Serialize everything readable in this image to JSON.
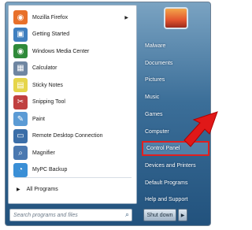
{
  "pinned": [
    {
      "label": "Mozilla Firefox",
      "icon": "firefox-icon",
      "color": "#e8702a",
      "glyph": "◉",
      "has_submenu": true
    },
    {
      "label": "Getting Started",
      "icon": "getting-started-icon",
      "color": "#3f7fbf",
      "glyph": "▣"
    },
    {
      "label": "Windows Media Center",
      "icon": "media-center-icon",
      "color": "#2f8a3a",
      "glyph": "◉"
    },
    {
      "label": "Calculator",
      "icon": "calculator-icon",
      "color": "#6f86a2",
      "glyph": "▦"
    },
    {
      "label": "Sticky Notes",
      "icon": "sticky-notes-icon",
      "color": "#e6d54a",
      "glyph": "▤"
    },
    {
      "label": "Snipping Tool",
      "icon": "snipping-tool-icon",
      "color": "#c04040",
      "glyph": "✂"
    },
    {
      "label": "Paint",
      "icon": "paint-icon",
      "color": "#5b9bd5",
      "glyph": "✎"
    },
    {
      "label": "Remote Desktop Connection",
      "icon": "remote-desktop-icon",
      "color": "#3b6ea8",
      "glyph": "▭"
    },
    {
      "label": "Magnifier",
      "icon": "magnifier-icon",
      "color": "#4a78b0",
      "glyph": "⌕"
    },
    {
      "label": "MyPC Backup",
      "icon": "mypc-backup-icon",
      "color": "#3a8fd6",
      "glyph": "◔"
    }
  ],
  "all_programs": "All Programs",
  "search_placeholder": "Search programs and files",
  "right_items": [
    {
      "label": "Malware",
      "name": "right-item-malware"
    },
    {
      "label": "Documents",
      "name": "right-item-documents"
    },
    {
      "label": "Pictures",
      "name": "right-item-pictures"
    },
    {
      "label": "Music",
      "name": "right-item-music"
    },
    {
      "label": "Games",
      "name": "right-item-games"
    },
    {
      "label": "Computer",
      "name": "right-item-computer"
    },
    {
      "label": "Control Panel",
      "name": "right-item-control-panel",
      "highlighted": true
    },
    {
      "label": "Devices and Printers",
      "name": "right-item-devices-printers"
    },
    {
      "label": "Default Programs",
      "name": "right-item-default-programs"
    },
    {
      "label": "Help and Support",
      "name": "right-item-help-support"
    }
  ],
  "shutdown_label": "Shut down",
  "colors": {
    "highlight_border": "#e02020",
    "pointer_arrow": "#e01818"
  }
}
